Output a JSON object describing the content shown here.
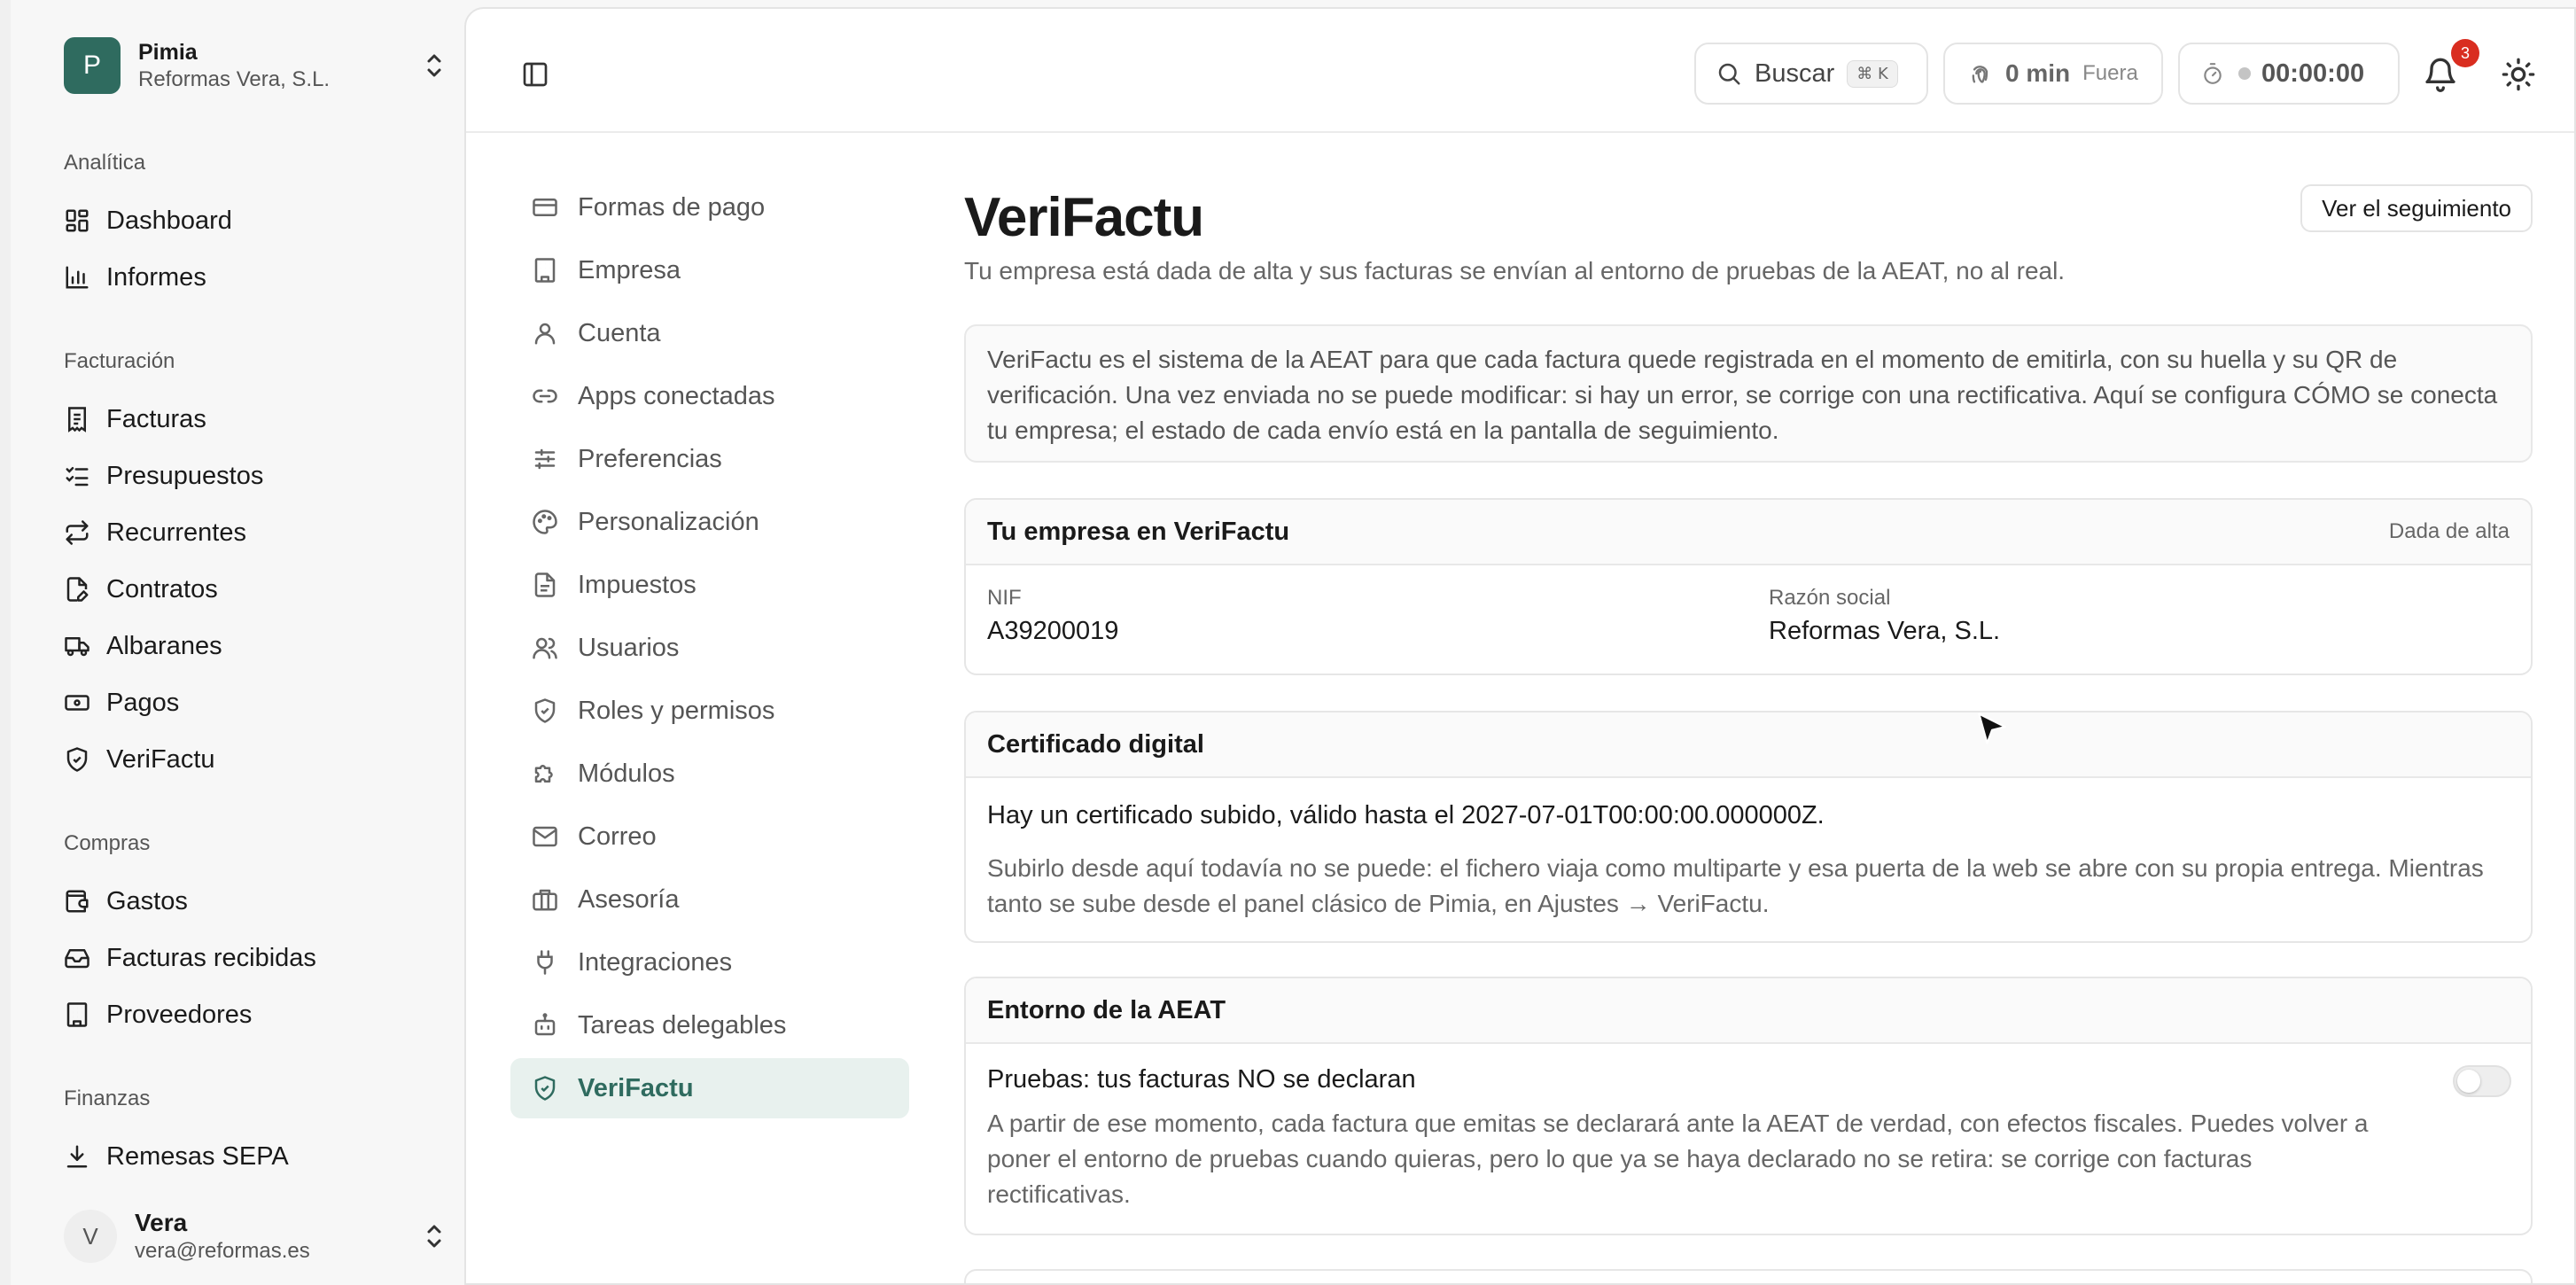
{
  "colors": {
    "accent": "#2f6b5f",
    "badge": "#d92d20",
    "active_bg": "#e8f1ee"
  },
  "workspace": {
    "avatar_letter": "P",
    "name": "Pimia",
    "company": "Reformas Vera, S.L."
  },
  "sidebar": {
    "sections": [
      {
        "label": "Analítica",
        "items": [
          {
            "label": "Dashboard",
            "icon": "dashboard-icon"
          },
          {
            "label": "Informes",
            "icon": "bar-chart-icon"
          }
        ]
      },
      {
        "label": "Facturación",
        "items": [
          {
            "label": "Facturas",
            "icon": "receipt-icon"
          },
          {
            "label": "Presupuestos",
            "icon": "list-check-icon"
          },
          {
            "label": "Recurrentes",
            "icon": "repeat-icon"
          },
          {
            "label": "Contratos",
            "icon": "file-pen-icon"
          },
          {
            "label": "Albaranes",
            "icon": "truck-icon"
          },
          {
            "label": "Pagos",
            "icon": "banknote-icon"
          },
          {
            "label": "VeriFactu",
            "icon": "shield-check-icon"
          }
        ]
      },
      {
        "label": "Compras",
        "items": [
          {
            "label": "Gastos",
            "icon": "wallet-icon"
          },
          {
            "label": "Facturas recibidas",
            "icon": "inbox-icon"
          },
          {
            "label": "Proveedores",
            "icon": "building-icon"
          }
        ]
      },
      {
        "label": "Finanzas",
        "items": [
          {
            "label": "Remesas SEPA",
            "icon": "download-icon"
          }
        ]
      }
    ]
  },
  "user": {
    "avatar_letter": "V",
    "name": "Vera",
    "email": "vera@reformas.es"
  },
  "topbar": {
    "search_label": "Buscar",
    "search_shortcut": "⌘ K",
    "time_value": "0 min",
    "time_state": "Fuera",
    "timer_value": "00:00:00",
    "notifications_count": "3"
  },
  "settings_nav": [
    {
      "label": "Formas de pago",
      "icon": "credit-card-icon"
    },
    {
      "label": "Empresa",
      "icon": "building-icon"
    },
    {
      "label": "Cuenta",
      "icon": "user-icon"
    },
    {
      "label": "Apps conectadas",
      "icon": "link-icon"
    },
    {
      "label": "Preferencias",
      "icon": "sliders-icon"
    },
    {
      "label": "Personalización",
      "icon": "palette-icon"
    },
    {
      "label": "Impuestos",
      "icon": "file-text-icon"
    },
    {
      "label": "Usuarios",
      "icon": "users-icon"
    },
    {
      "label": "Roles y permisos",
      "icon": "shield-icon"
    },
    {
      "label": "Módulos",
      "icon": "puzzle-icon"
    },
    {
      "label": "Correo",
      "icon": "mail-icon"
    },
    {
      "label": "Asesoría",
      "icon": "briefcase-icon"
    },
    {
      "label": "Integraciones",
      "icon": "plug-icon"
    },
    {
      "label": "Tareas delegables",
      "icon": "bot-icon"
    },
    {
      "label": "VeriFactu",
      "icon": "shield-check-icon",
      "active": true
    }
  ],
  "page": {
    "title": "VeriFactu",
    "subtitle": "Tu empresa está dada de alta y sus facturas se envían al entorno de pruebas de la AEAT, no al real.",
    "tracking_button": "Ver el seguimiento",
    "info": "VeriFactu es el sistema de la AEAT para que cada factura quede registrada en el momento de emitirla, con su huella y su QR de verificación. Una vez enviada no se puede modificar: si hay un error, se corrige con una rectificativa. Aquí se configura CÓMO se conecta tu empresa; el estado de cada envío está en la pantalla de seguimiento.",
    "company_card": {
      "title": "Tu empresa en VeriFactu",
      "status": "Dada de alta",
      "nif_label": "NIF",
      "nif_value": "A39200019",
      "razon_label": "Razón social",
      "razon_value": "Reformas Vera, S.L."
    },
    "cert_card": {
      "title": "Certificado digital",
      "status_line": "Hay un certificado subido, válido hasta el 2027-07-01T00:00:00.000000Z.",
      "note": "Subirlo desde aquí todavía no se puede: el fichero viaja como multiparte y esa puerta de la web se abre con su propia entrega. Mientras tanto se sube desde el panel clásico de Pimia, en Ajustes → VeriFactu."
    },
    "env_card": {
      "title": "Entorno de la AEAT",
      "toggle_label": "Pruebas: tus facturas NO se declaran",
      "toggle_on": false,
      "description": "A partir de ese momento, cada factura que emitas se declarará ante la AEAT de verdad, con efectos fiscales. Puedes volver a poner el entorno de pruebas cuando quieras, pero lo que ya se haya declarado no se retira: se corrige con facturas rectificativas."
    }
  }
}
